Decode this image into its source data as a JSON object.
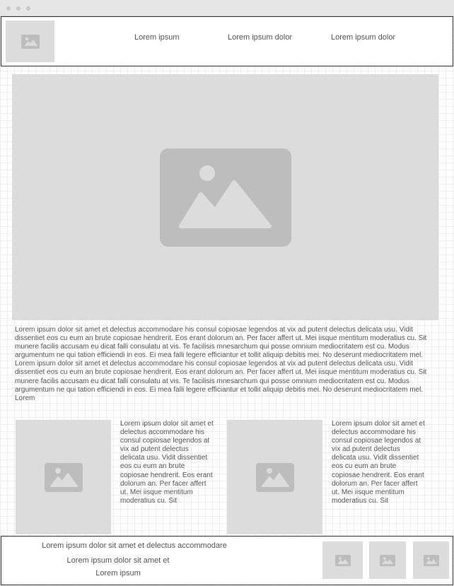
{
  "window": {
    "controls": [
      "close-dot",
      "minimize-dot",
      "maximize-dot"
    ]
  },
  "header": {
    "logo_icon": "image-placeholder-icon",
    "nav": [
      {
        "label": "Lorem ipsum"
      },
      {
        "label": "Lorem ipsum dolor"
      },
      {
        "label": "Lorem ipsum dolor"
      }
    ]
  },
  "main": {
    "hero_icon": "image-placeholder-icon",
    "paragraph": "Lorem ipsum dolor sit amet et delectus accommodare his consul copiosae legendos at vix ad putent delectus delicata usu. Vidit dissentiet eos cu eum an brute copiosae hendrerit. Eos erant dolorum an. Per facer affert ut. Mei iisque mentitum moderatius cu. Sit munere facilis accusam eu dicat falli consulatu at vis. Te facilisis mnesarchum qui posse omnium mediocritatem est cu. Modus argumentum ne qui tation efficiendi in eos. Ei mea falli legere efficiantur et tollit aliquip debitis mei. No deserunt mediocritatem mel. Lorem ipsum dolor sit amet et delectus accommodare his consul copiosae legendos at vix ad putent delectus delicata usu. Vidit dissentiet eos cu eum an brute copiosae hendrerit. Eos erant dolorum an. Per facer affert ut. Mei iisque mentitum moderatius cu. Sit munere facilis accusam eu dicat falli consulatu at vis. Te facilisis mnesarchum qui posse omnium mediocritatem est cu. Modus argumentum ne qui tation efficiendi in eos. Ei mea falli legere efficiantur et tollit aliquip debitis mei. No deserunt mediocritatem mel. Lorem",
    "cards": [
      {
        "icon": "image-placeholder-icon",
        "text": "Lorem ipsum dolor sit amet et delectus accommodare his consul copiosae legendos at vix ad putent delectus delicata usu. Vidit dissentiet eos cu eum an brute copiosae hendrerit. Eos erant dolorum an. Per facer affert ut. Mei iisque mentitum moderatius cu. Sit"
      },
      {
        "icon": "image-placeholder-icon",
        "text": "Lorem ipsum dolor sit amet et delectus accommodare his consul copiosae legendos at vix ad putent delectus delicata usu. Vidit dissentiet eos cu eum an brute copiosae hendrerit. Eos erant dolorum an. Per facer affert ut. Mei iisque mentitum moderatius cu. Sit"
      }
    ]
  },
  "footer": {
    "lines": [
      "Lorem ipsum dolor sit amet et delectus accommodare",
      "Lorem ipsum dolor sit amet et",
      "Lorem ipsum"
    ],
    "thumbnails": [
      {
        "icon": "image-placeholder-icon"
      },
      {
        "icon": "image-placeholder-icon"
      },
      {
        "icon": "image-placeholder-icon"
      }
    ]
  }
}
